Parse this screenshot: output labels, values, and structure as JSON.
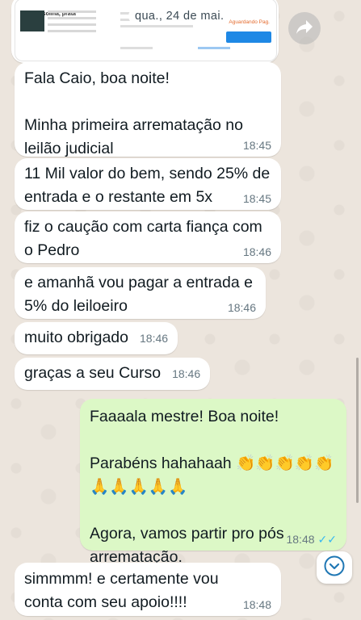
{
  "date_chip": "qua., 24 de mai.",
  "image_message": {
    "title": "1/02, gasolina, prata",
    "status": "Aguardando Pag."
  },
  "messages": [
    {
      "text": "Fala Caio, boa noite!\n\nMinha primeira arrematação no leilão judicial",
      "time": "18:45"
    },
    {
      "text": "11 Mil valor do bem, sendo 25% de entrada e o restante em 5x",
      "time": "18:45"
    },
    {
      "text": "fiz o caução com carta fiança com o Pedro",
      "time": "18:46"
    },
    {
      "text": "e amanhã vou pagar a entrada e 5% do leiloeiro",
      "time": "18:46"
    },
    {
      "text": "muito obrigado",
      "time": "18:46"
    },
    {
      "text": "graças a seu Curso",
      "time": "18:46"
    },
    {
      "text": "Faaaala mestre! Boa noite!\n\nParabéns hahahaah 👏👏👏👏👏\n🙏🙏🙏🙏🙏\n\nAgora, vamos partir pro pós arrematação.",
      "time": "18:48",
      "status": "✓✓"
    },
    {
      "text": "simmmm! e certamente vou conta com seu apoio!!!!",
      "time": "18:48"
    }
  ],
  "icons": {
    "forward": "forward-arrow-icon",
    "scroll_down": "chevron-down-circle-icon",
    "read_receipt": "double-check-icon"
  },
  "colors": {
    "incoming_bubble": "#ffffff",
    "outgoing_bubble": "#dcf8c6",
    "read_check": "#34b7f1",
    "chat_background": "#ece5dd"
  }
}
